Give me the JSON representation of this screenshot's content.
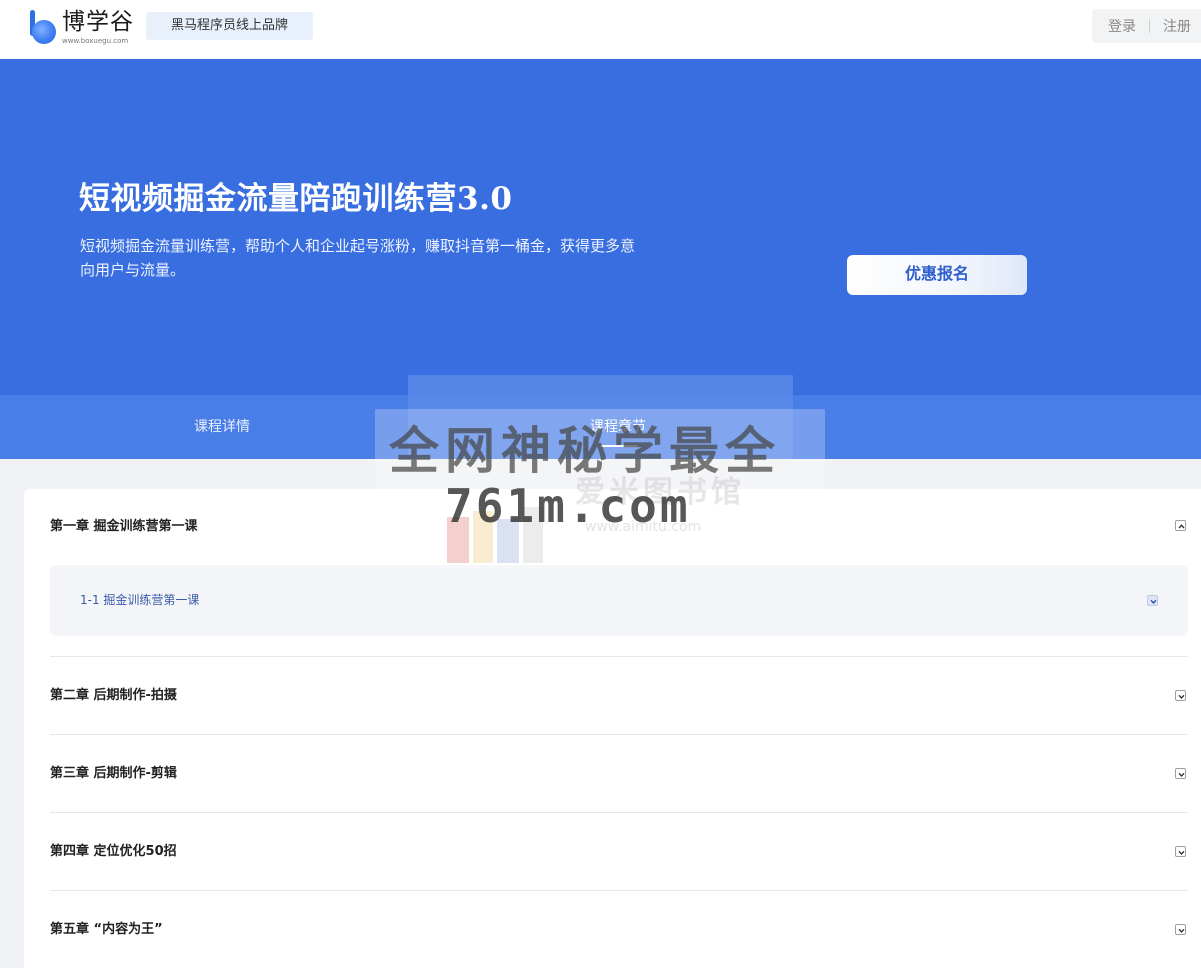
{
  "header": {
    "logo_name": "博学谷",
    "logo_url": "www.boxuegu.com",
    "brand_tag": "黑马程序员线上品牌",
    "login_label": "登录",
    "register_label": "注册"
  },
  "hero": {
    "title": "短视频掘金流量陪跑训练营3.0",
    "description": "短视频掘金流量训练营，帮助个人和企业起号涨粉，赚取抖音第一桶金，获得更多意向用户与流量。",
    "enroll_label": "优惠报名",
    "background_color": "#386ee0"
  },
  "tabs": [
    {
      "label": "课程详情"
    },
    {
      "label": "课程章节"
    }
  ],
  "chapters": [
    {
      "title": "第一章 掘金训练营第一课",
      "expanded": true,
      "lessons": [
        {
          "title": "1-1 掘金训练营第一课"
        }
      ]
    },
    {
      "title": "第二章 后期制作-拍摄",
      "expanded": false
    },
    {
      "title": "第三章 后期制作-剪辑",
      "expanded": false
    },
    {
      "title": "第四章 定位优化50招",
      "expanded": false
    },
    {
      "title": "第五章 “内容为王”",
      "expanded": false
    }
  ],
  "watermark": {
    "line1": "全网神秘学最全",
    "line2": "761m.com",
    "ghost1": "爱米图书馆",
    "ghost2": "www.aimitu.com"
  },
  "icons": {
    "expand": "chevron-down-icon",
    "collapse": "chevron-up-icon"
  }
}
